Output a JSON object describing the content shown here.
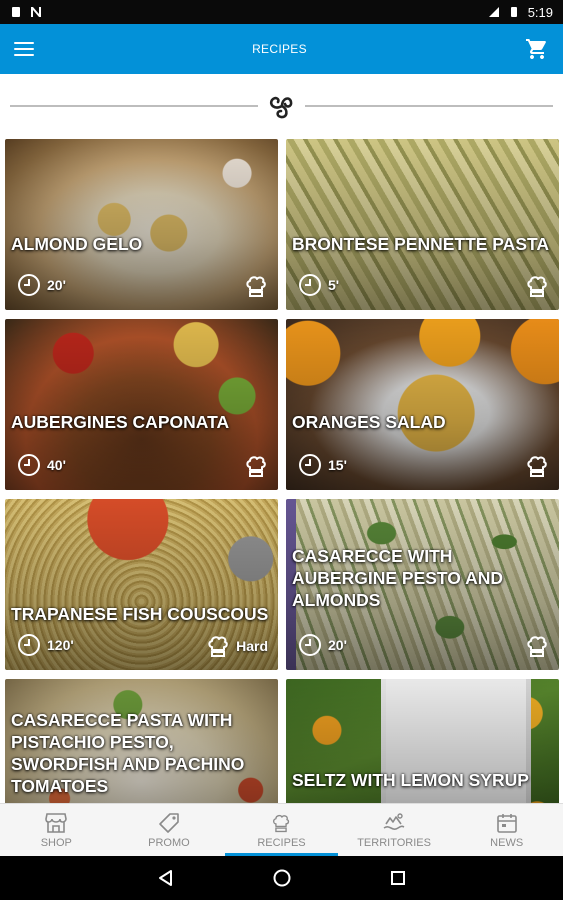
{
  "status_bar": {
    "time": "5:19"
  },
  "app_bar": {
    "title": "RECIPES"
  },
  "recipes": [
    {
      "name": "ALMOND GELO",
      "time": "20'",
      "difficulty": ""
    },
    {
      "name": "BRONTESE PENNETTE PASTA",
      "time": "5'",
      "difficulty": ""
    },
    {
      "name": "AUBERGINES CAPONATA",
      "time": "40'",
      "difficulty": ""
    },
    {
      "name": "ORANGES SALAD",
      "time": "15'",
      "difficulty": ""
    },
    {
      "name": "TRAPANESE FISH COUSCOUS",
      "time": "120'",
      "difficulty": "Hard"
    },
    {
      "name": "CASARECCE WITH AUBERGINE PESTO AND ALMONDS",
      "time": "20'",
      "difficulty": ""
    },
    {
      "name": "CASARECCE PASTA WITH PISTACHIO PESTO, SWORDFISH AND PACHINO TOMATOES",
      "time": "",
      "difficulty": ""
    },
    {
      "name": "SELTZ WITH LEMON SYRUP",
      "time": "",
      "difficulty": ""
    }
  ],
  "bottom_nav": [
    {
      "label": "SHOP",
      "icon": "shop-icon"
    },
    {
      "label": "PROMO",
      "icon": "tag-icon"
    },
    {
      "label": "RECIPES",
      "icon": "chef-hat-icon",
      "active": true
    },
    {
      "label": "TERRITORIES",
      "icon": "territories-icon"
    },
    {
      "label": "NEWS",
      "icon": "calendar-icon"
    }
  ],
  "colors": {
    "primary": "#0391d8",
    "nav_bg": "#f5f5f5",
    "status_bg": "#0a0a0a"
  }
}
